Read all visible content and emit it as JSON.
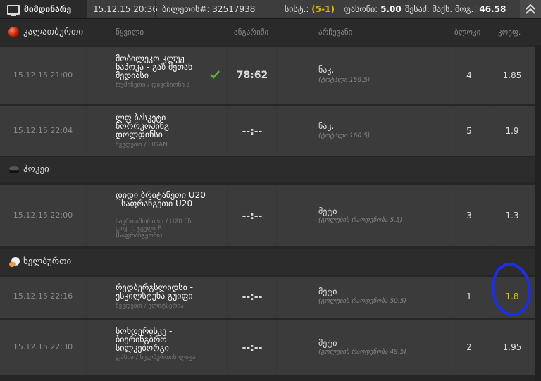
{
  "topbar": {
    "live_tab": "მიმდინარე",
    "datetime": "15.12.15 20:36",
    "ticket_label": "ბილეთის#",
    "ticket_no": ": 32517938",
    "system_label": "სის​ტ.:",
    "system_value": "(5-1)",
    "price_label": "ფასონი:",
    "price_value": "5.00",
    "max_win_label": "შესაძ. მაქს. მოგ.:",
    "max_win_value": "46.58"
  },
  "header": {
    "sport": "კალათბურთი",
    "col_event": "წყვილი",
    "col_score": "ანგარიში",
    "col_pick": "არჩევანი",
    "col_block": "ბლოკი",
    "col_odds": "კოეფ."
  },
  "rows": [
    {
      "time": "15.12.15 21:00",
      "team": "მობილეკო კლუჟ ნაპოკა - გაზ მეთან მედიასი",
      "league": "რუმინეთი / დივიზიონი ა",
      "score": "78:62",
      "pick": "ნაკ.",
      "sub": "(ტოტალი 159.5)",
      "block": "4",
      "odds": "1.85"
    },
    {
      "time": "15.12.15 22:04",
      "team": "ლფ ბასკეტი - ნორრკოპინგ დოლფინსი",
      "league": "შვედეთი / LIGAN",
      "score": "--:--",
      "pick": "ნაკ.",
      "sub": "(ტოტალი 160.5)",
      "block": "5",
      "odds": "1.9"
    },
    {
      "time": "15.12.15 22:00",
      "team": "დიდი ბრიტანეთი U20 - საფრანგეთი U20",
      "league": "საერთაშორისო / U20 მჩ. დივ. I, ჯგუფი B (საფრანგეთში)",
      "score": "--:--",
      "pick": "მეტი",
      "sub": "(გოლების რაოდენობა 5.5)",
      "block": "3",
      "odds": "1.3"
    },
    {
      "time": "15.12.15 22:16",
      "team": "რედბერგსლიდსი - ესკილსტუნა გუიფი",
      "league": "შვედეთი / ელიტსერია",
      "score": "--:--",
      "pick": "მეტი",
      "sub": "(გოლების რაოდენობა 50.5)",
      "block": "1",
      "odds": "1.8"
    },
    {
      "time": "15.12.15 22:30",
      "team": "სონდერისკე - ბიერინგბრო სილკებორგი",
      "league": "დანია / ხელბურთის ლიგა",
      "score": "--:--",
      "pick": "მეტი",
      "sub": "(გოლების რაოდენობა 49.5)",
      "block": "2",
      "odds": "1.95"
    }
  ],
  "sections": {
    "hockey": "ჰოკეი",
    "handball": "ხელბურთი"
  },
  "colors": {
    "highlight_odds": "#d8c800",
    "annotation": "#1c2ee8",
    "system": "#e0b800"
  }
}
